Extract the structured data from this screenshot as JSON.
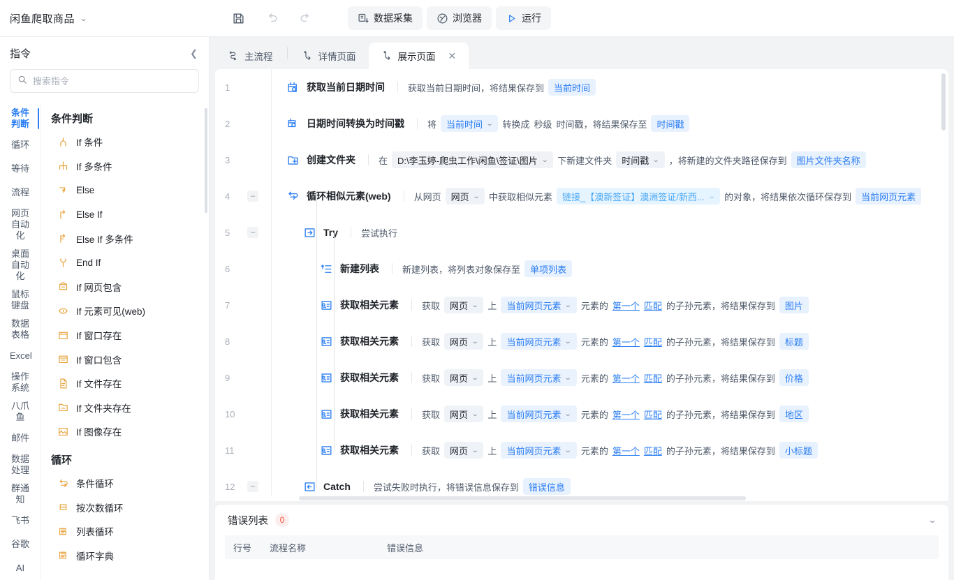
{
  "titlebar": {
    "doc_title": "闲鱼爬取商品",
    "dropdown_icon": "chevron-down-icon"
  },
  "toolbar": {
    "save_icon": "save-icon",
    "undo_icon": "undo-icon",
    "redo_icon": "redo-icon",
    "collect_label": "数据采集",
    "browser_label": "浏览器",
    "run_label": "运行"
  },
  "sidebar": {
    "header": "指令",
    "collapse_icon": "chevron-left-icon",
    "search": {
      "placeholder": "搜索指令",
      "value": "",
      "icon": "search-icon"
    },
    "categories": [
      {
        "label": "条件判断",
        "active": true
      },
      {
        "label": "循环",
        "active": false
      },
      {
        "label": "等待",
        "active": false
      },
      {
        "label": "流程",
        "active": false
      },
      {
        "label": "网页自动化",
        "active": false
      },
      {
        "label": "桌面自动化",
        "active": false
      },
      {
        "label": "鼠标键盘",
        "active": false
      },
      {
        "label": "数据表格",
        "active": false
      },
      {
        "label": "Excel",
        "active": false
      },
      {
        "label": "操作系统",
        "active": false
      },
      {
        "label": "八爪鱼",
        "active": false
      },
      {
        "label": "邮件",
        "active": false
      },
      {
        "label": "数据处理",
        "active": false
      },
      {
        "label": "群通知",
        "active": false
      },
      {
        "label": "飞书",
        "active": false
      },
      {
        "label": "谷歌",
        "active": false
      },
      {
        "label": "AI",
        "active": false
      }
    ],
    "groups": [
      {
        "title": "条件判断",
        "items": [
          {
            "label": "If 条件",
            "icon": "branch-icon"
          },
          {
            "label": "If 多条件",
            "icon": "multi-branch-icon"
          },
          {
            "label": "Else",
            "icon": "else-icon"
          },
          {
            "label": "Else If",
            "icon": "else-if-icon"
          },
          {
            "label": "Else If 多条件",
            "icon": "else-if-multi-icon"
          },
          {
            "label": "End If",
            "icon": "end-if-icon"
          },
          {
            "label": "If 网页包含",
            "icon": "web-contains-icon"
          },
          {
            "label": "If 元素可见(web)",
            "icon": "element-visible-icon"
          },
          {
            "label": "If 窗口存在",
            "icon": "window-exists-icon"
          },
          {
            "label": "If 窗口包含",
            "icon": "window-contains-icon"
          },
          {
            "label": "If 文件存在",
            "icon": "file-exists-icon"
          },
          {
            "label": "If 文件夹存在",
            "icon": "folder-exists-icon"
          },
          {
            "label": "If 图像存在",
            "icon": "image-exists-icon"
          }
        ]
      },
      {
        "title": "循环",
        "items": [
          {
            "label": "条件循环",
            "icon": "loop-condition-icon"
          },
          {
            "label": "按次数循环",
            "icon": "loop-count-icon"
          },
          {
            "label": "列表循环",
            "icon": "loop-list-icon"
          },
          {
            "label": "循环字典",
            "icon": "loop-dict-icon"
          }
        ]
      }
    ]
  },
  "tabs": [
    {
      "label": "主流程",
      "icon": "flow-icon",
      "active": false,
      "closable": false
    },
    {
      "label": "详情页面",
      "icon": "subflow-icon",
      "active": false,
      "closable": false
    },
    {
      "label": "展示页面",
      "icon": "subflow-icon",
      "active": true,
      "closable": true,
      "close_icon": "close-icon"
    }
  ],
  "flow": {
    "rows": [
      {
        "num": "1",
        "fold": false,
        "indent": 0,
        "icon": "calendar-clock-icon",
        "name": "获取当前日期时间",
        "parts": [
          {
            "t": "text",
            "v": "获取当前日期时间，将结果保存到"
          },
          {
            "t": "var",
            "v": "当前时间"
          }
        ]
      },
      {
        "num": "2",
        "fold": false,
        "indent": 0,
        "icon": "datetime-convert-icon",
        "name": "日期时间转换为时间戳",
        "parts": [
          {
            "t": "text",
            "v": "将"
          },
          {
            "t": "select-blue",
            "v": "当前时间"
          },
          {
            "t": "text",
            "v": "转换成"
          },
          {
            "t": "text",
            "v": "秒级"
          },
          {
            "t": "text",
            "v": "时间戳，将结果保存至"
          },
          {
            "t": "var",
            "v": "时间戳"
          }
        ]
      },
      {
        "num": "3",
        "fold": false,
        "indent": 0,
        "icon": "folder-plus-icon",
        "name": "创建文件夹",
        "parts": [
          {
            "t": "text",
            "v": "在"
          },
          {
            "t": "path",
            "v": "D:\\李玉婷-爬虫工作\\闲鱼\\签证\\图片"
          },
          {
            "t": "text",
            "v": "下新建文件夹"
          },
          {
            "t": "select",
            "v": "时间戳"
          },
          {
            "t": "text",
            "v": "，将新建的文件夹路径保存到"
          },
          {
            "t": "var",
            "v": "图片文件夹名称"
          }
        ]
      },
      {
        "num": "4",
        "fold": true,
        "indent": 0,
        "icon": "loop-similar-icon",
        "name": "循环相似元素(web)",
        "parts": [
          {
            "t": "text",
            "v": "从网页"
          },
          {
            "t": "select",
            "v": "网页"
          },
          {
            "t": "text",
            "v": "中获取相似元素"
          },
          {
            "t": "link",
            "v": "链接_【澳新签证】澳洲签证/新西..."
          },
          {
            "t": "text",
            "v": "的对象，将结果依次循环保存到"
          },
          {
            "t": "var",
            "v": "当前网页元素"
          }
        ]
      },
      {
        "num": "5",
        "fold": true,
        "indent": 1,
        "icon": "try-icon",
        "name": "Try",
        "parts": [
          {
            "t": "text",
            "v": "尝试执行"
          }
        ]
      },
      {
        "num": "6",
        "fold": false,
        "indent": 2,
        "icon": "new-list-icon",
        "name": "新建列表",
        "parts": [
          {
            "t": "text",
            "v": "新建列表，将列表对象保存至"
          },
          {
            "t": "var",
            "v": "单项列表"
          }
        ]
      },
      {
        "num": "7",
        "fold": false,
        "indent": 2,
        "icon": "get-related-icon",
        "name": "获取相关元素",
        "parts": [
          {
            "t": "text",
            "v": "获取"
          },
          {
            "t": "select",
            "v": "网页"
          },
          {
            "t": "text",
            "v": "上"
          },
          {
            "t": "select-blue",
            "v": "当前网页元素"
          },
          {
            "t": "text",
            "v": "元素的"
          },
          {
            "t": "ul",
            "v": "第一个"
          },
          {
            "t": "ul",
            "v": "匹配"
          },
          {
            "t": "text",
            "v": "的子孙元素，将结果保存到"
          },
          {
            "t": "var",
            "v": "图片"
          }
        ]
      },
      {
        "num": "8",
        "fold": false,
        "indent": 2,
        "icon": "get-related-icon",
        "name": "获取相关元素",
        "parts": [
          {
            "t": "text",
            "v": "获取"
          },
          {
            "t": "select",
            "v": "网页"
          },
          {
            "t": "text",
            "v": "上"
          },
          {
            "t": "select-blue",
            "v": "当前网页元素"
          },
          {
            "t": "text",
            "v": "元素的"
          },
          {
            "t": "ul",
            "v": "第一个"
          },
          {
            "t": "ul",
            "v": "匹配"
          },
          {
            "t": "text",
            "v": "的子孙元素，将结果保存到"
          },
          {
            "t": "var",
            "v": "标题"
          }
        ]
      },
      {
        "num": "9",
        "fold": false,
        "indent": 2,
        "icon": "get-related-icon",
        "name": "获取相关元素",
        "parts": [
          {
            "t": "text",
            "v": "获取"
          },
          {
            "t": "select",
            "v": "网页"
          },
          {
            "t": "text",
            "v": "上"
          },
          {
            "t": "select-blue",
            "v": "当前网页元素"
          },
          {
            "t": "text",
            "v": "元素的"
          },
          {
            "t": "ul",
            "v": "第一个"
          },
          {
            "t": "ul",
            "v": "匹配"
          },
          {
            "t": "text",
            "v": "的子孙元素，将结果保存到"
          },
          {
            "t": "var",
            "v": "价格"
          }
        ]
      },
      {
        "num": "10",
        "fold": false,
        "indent": 2,
        "icon": "get-related-icon",
        "name": "获取相关元素",
        "parts": [
          {
            "t": "text",
            "v": "获取"
          },
          {
            "t": "select",
            "v": "网页"
          },
          {
            "t": "text",
            "v": "上"
          },
          {
            "t": "select-blue",
            "v": "当前网页元素"
          },
          {
            "t": "text",
            "v": "元素的"
          },
          {
            "t": "ul",
            "v": "第一个"
          },
          {
            "t": "ul",
            "v": "匹配"
          },
          {
            "t": "text",
            "v": "的子孙元素，将结果保存到"
          },
          {
            "t": "var",
            "v": "地区"
          }
        ]
      },
      {
        "num": "11",
        "fold": false,
        "indent": 2,
        "icon": "get-related-icon",
        "name": "获取相关元素",
        "parts": [
          {
            "t": "text",
            "v": "获取"
          },
          {
            "t": "select",
            "v": "网页"
          },
          {
            "t": "text",
            "v": "上"
          },
          {
            "t": "select-blue",
            "v": "当前网页元素"
          },
          {
            "t": "text",
            "v": "元素的"
          },
          {
            "t": "ul",
            "v": "第一个"
          },
          {
            "t": "ul",
            "v": "匹配"
          },
          {
            "t": "text",
            "v": "的子孙元素，将结果保存到"
          },
          {
            "t": "var",
            "v": "小标题"
          }
        ]
      },
      {
        "num": "12",
        "fold": true,
        "indent": 1,
        "icon": "catch-icon",
        "name": "Catch",
        "parts": [
          {
            "t": "text",
            "v": "尝试失败时执行，将错误信息保存到"
          },
          {
            "t": "var",
            "v": "错误信息"
          }
        ]
      }
    ]
  },
  "errors": {
    "title": "错误列表",
    "count": "0",
    "chevron_icon": "chevron-down-icon",
    "columns": [
      "行号",
      "流程名称",
      "错误信息"
    ],
    "rows": []
  },
  "colors": {
    "accent": "#2b7ef3",
    "var_bg": "#e8f1fe",
    "link": "#46a6f5",
    "error_red": "#f5503a"
  }
}
